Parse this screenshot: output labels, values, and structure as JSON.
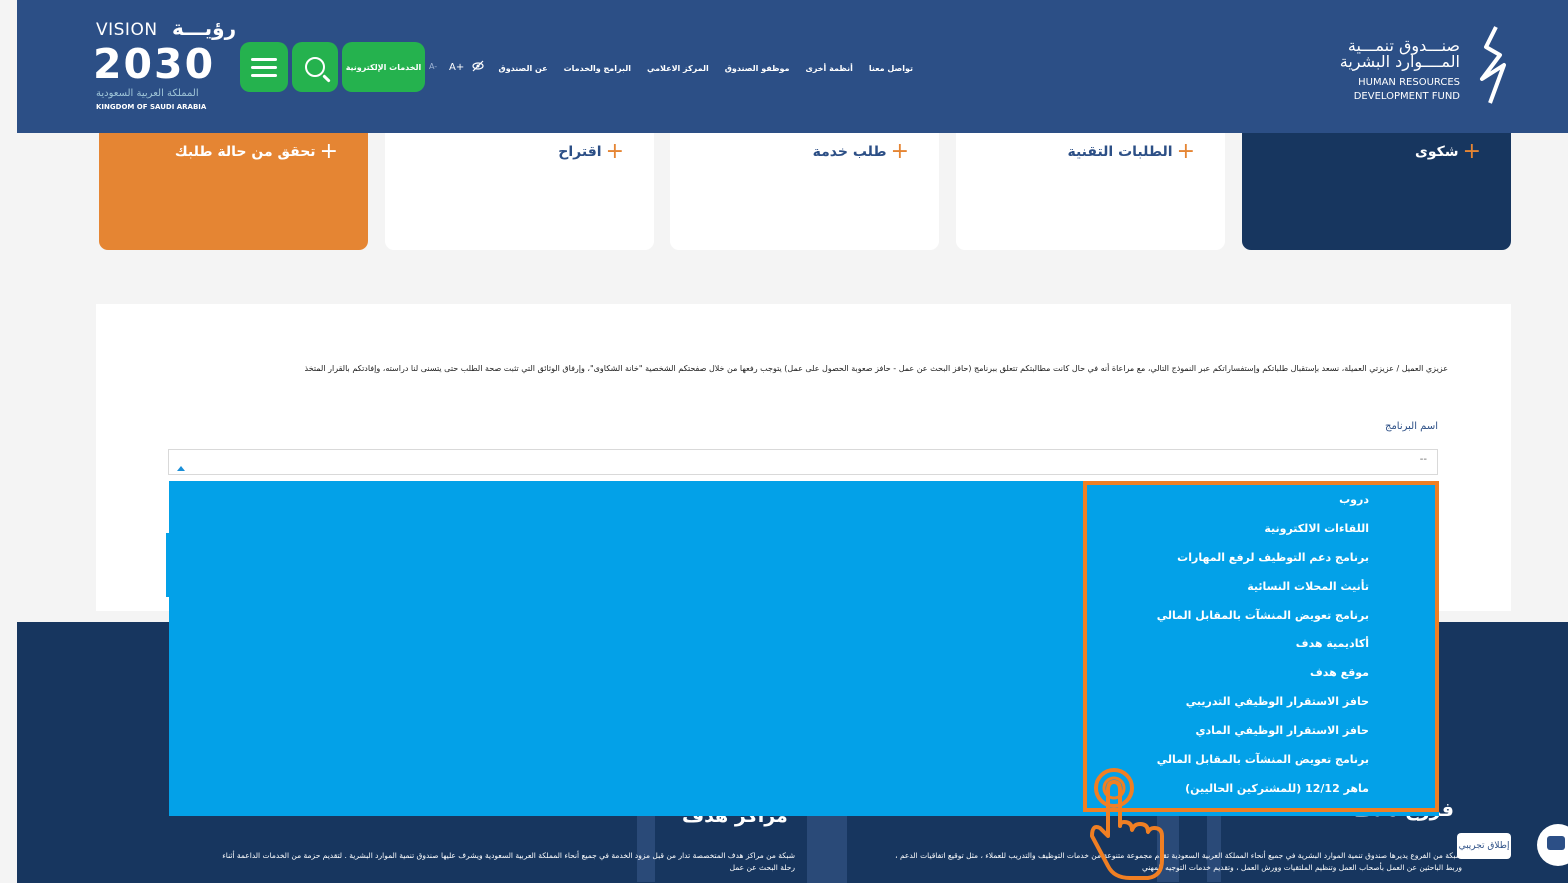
{
  "header": {
    "vision": {
      "word": "VISION",
      "arabic_word": "رؤيـــة",
      "year": "2030",
      "kingdom_ar": "المملكة العربية السعودية",
      "kingdom_en": "KINGDOM OF SAUDI ARABIA"
    },
    "e_services_label": "الخدمات الإلكترونية",
    "text_size_small": "A-",
    "text_size_large": "A+",
    "nav": [
      "عن الصندوق",
      "البرامج والخدمات",
      "المركز الاعلامي",
      "موظفو الصندوق",
      "أنظمة أخرى",
      "تواصل معنا"
    ],
    "hrdf": {
      "ar_line1": "صنـــدوق تنمـــية",
      "ar_line2": "المــــوارد البشرية",
      "en_line1": "HUMAN RESOURCES",
      "en_line2": "DEVELOPMENT FUND"
    }
  },
  "cards": {
    "complaint": "شكوى",
    "technical": "الطلبات التقنية",
    "service": "طلب خدمة",
    "suggestion": "اقتراح",
    "status": "تحقق من حالة طلبك",
    "plus": "+"
  },
  "form": {
    "notice": "عزيزي العميل / عزيزتي العميلة، نسعد بإستقبال طلباتكم وإستفساراتكم عبر النموذج التالي، مع مراعاة أنه في حال كانت مطالبتكم تتعلق ببرنامج (حافز البحث عن عمل - حافز صعوبة الحصول على عمل) يتوجب رفعها من خلال صفحتكم الشخصية \"خانة الشكاوى\"، وإرفاق الوثائق التي تثبت صحة الطلب حتى يتسنى لنا دراسته، وإفادتكم بالقرار المتخذ",
    "program_label": "اسم البرنامج",
    "program_value": "--",
    "options": [
      "دروب",
      "اللقاءات الالكترونية",
      "برنامج دعم التوظيف لرفع المهارات",
      "تأنيث المحلات النسائية",
      "برنامج تعويض المنشآت بالمقابل المالي",
      "أكاديمية هدف",
      "موقع هدف",
      "حافز الاستقرار الوظيفي التدريبي",
      "حافز الاستقرار الوظيفي المادي",
      "برنامج تعويض المنشآت بالمقابل المالي",
      "ماهر 12/12 (للمشتركين الحاليين)"
    ]
  },
  "footer": {
    "branches_title": "فروع هدف",
    "branches_text": "شبكة من الفروع يديرها صندوق تنمية الموارد البشرية في جميع أنحاء المملكة العربية السعودية تقدم مجموعة متنوعة من خدمات التوظيف والتدريب للعملاء ، مثل توقيع اتفاقيات الدعم ، وربط الباحثين عن العمل بأصحاب العمل وتنظيم الملتقيات وورش العمل ، وتقديم خدمات التوجيه المهني",
    "centers_title": "مراكز هدف",
    "centers_text": "شبكة من مراكز هدف المتخصصة تدار من قبل مزود الخدمة في جميع أنحاء المملكة العربية السعودية ويشرف عليها صندوق تنمية الموارد البشرية . لتقديم حزمة من الخدمات الداعمة أثناء رحلة البحث عن عمل"
  },
  "widgets": {
    "trial_label": "إطلاق تجريبي"
  },
  "colors": {
    "header_bg": "#2c4f86",
    "footer_bg": "#17365f",
    "accent_orange": "#e58533",
    "green": "#25b24e",
    "dropdown_bg": "#03a1e8",
    "highlight": "#f07f23"
  }
}
